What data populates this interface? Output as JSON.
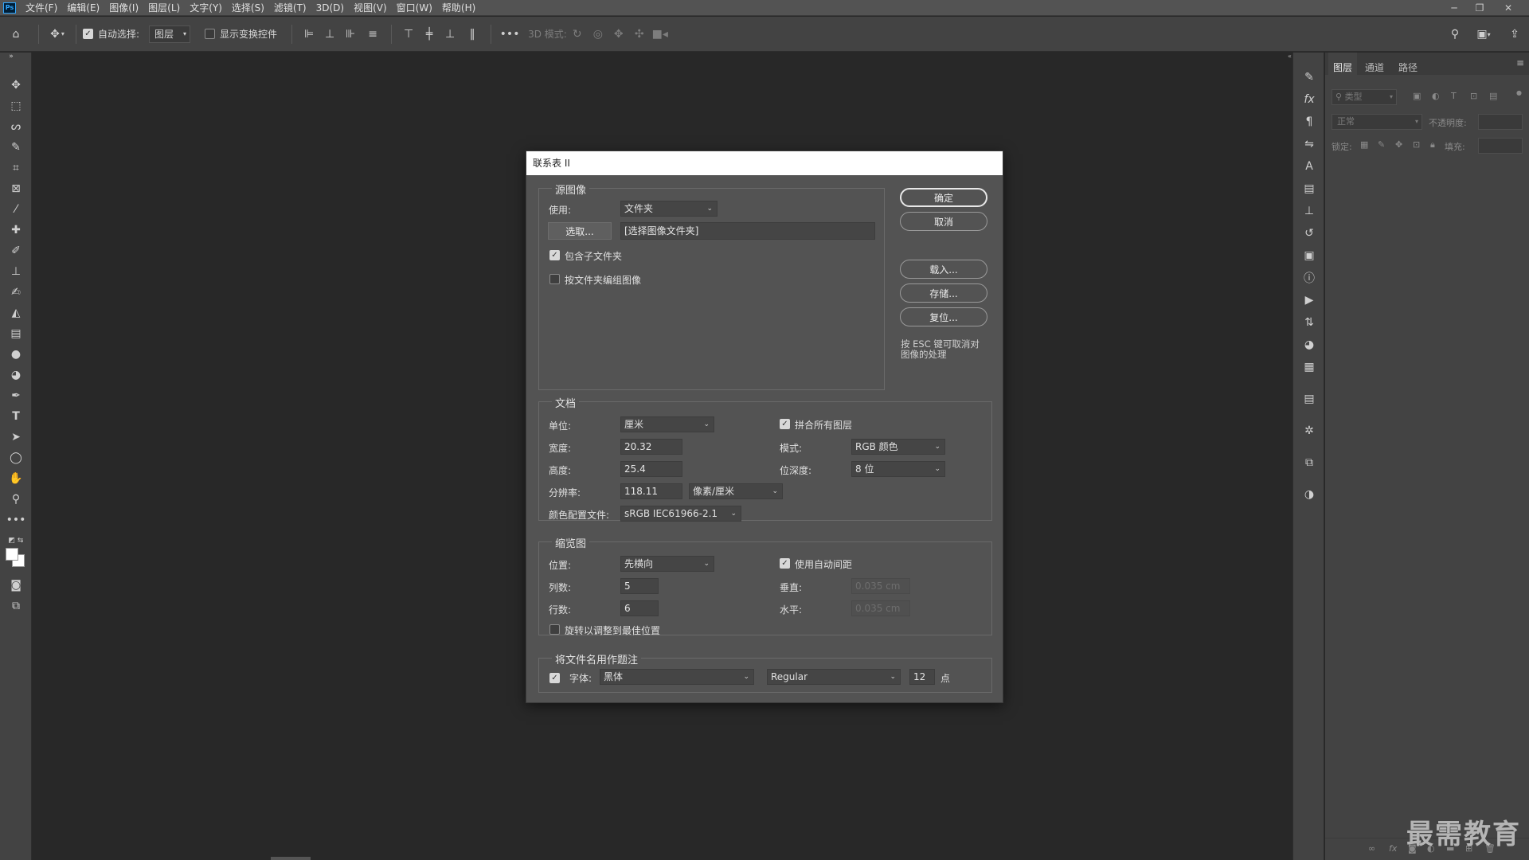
{
  "menubar": {
    "logo": "Ps",
    "items": [
      "文件(F)",
      "编辑(E)",
      "图像(I)",
      "图层(L)",
      "文字(Y)",
      "选择(S)",
      "滤镜(T)",
      "3D(D)",
      "视图(V)",
      "窗口(W)",
      "帮助(H)"
    ]
  },
  "options": {
    "auto_select_label": "自动选择:",
    "auto_select_checked": true,
    "layer_select": "图层",
    "show_transform_label": "显示变换控件",
    "show_transform_checked": false,
    "mode_3d_label": "3D 模式:"
  },
  "panel": {
    "tabs": [
      "图层",
      "通道",
      "路径"
    ],
    "search_placeholder": "类型",
    "blend_mode": "正常",
    "opacity_label": "不透明度:",
    "lock_label": "锁定:",
    "fill_label": "填充:"
  },
  "dialog": {
    "title": "联系表 II",
    "source": {
      "group_label": "源图像",
      "use_label": "使用:",
      "use_value": "文件夹",
      "choose_button": "选取...",
      "folder_path": "[选择图像文件夹]",
      "include_subfolders_label": "包含子文件夹",
      "include_subfolders_checked": true,
      "group_by_folder_label": "按文件夹编组图像",
      "group_by_folder_checked": false
    },
    "buttons": {
      "ok": "确定",
      "cancel": "取消",
      "load": "载入...",
      "save": "存储...",
      "reset": "复位..."
    },
    "esc_hint": "按 ESC 键可取消对图像的处理",
    "document": {
      "group_label": "文档",
      "unit_label": "单位:",
      "unit_value": "厘米",
      "width_label": "宽度:",
      "width_value": "20.32",
      "height_label": "高度:",
      "height_value": "25.4",
      "resolution_label": "分辨率:",
      "resolution_value": "118.11",
      "resolution_unit": "像素/厘米",
      "color_profile_label": "颜色配置文件:",
      "color_profile_value": "sRGB IEC61966-2.1",
      "flatten_label": "拼合所有图层",
      "flatten_checked": true,
      "mode_label": "模式:",
      "mode_value": "RGB 颜色",
      "bit_depth_label": "位深度:",
      "bit_depth_value": "8 位"
    },
    "thumbnails": {
      "group_label": "缩览图",
      "place_label": "位置:",
      "place_value": "先横向",
      "columns_label": "列数:",
      "columns_value": "5",
      "rows_label": "行数:",
      "rows_value": "6",
      "rotate_label": "旋转以调整到最佳位置",
      "rotate_checked": false,
      "auto_spacing_label": "使用自动间距",
      "auto_spacing_checked": true,
      "vertical_label": "垂直:",
      "vertical_value": "0.035 cm",
      "horizontal_label": "水平:",
      "horizontal_value": "0.035 cm"
    },
    "caption": {
      "group_label": "将文件名用作题注",
      "enabled": true,
      "font_label": "字体:",
      "font_value": "黑体",
      "style_value": "Regular",
      "size_value": "12",
      "size_unit": "点"
    }
  },
  "watermark": "最需教育"
}
